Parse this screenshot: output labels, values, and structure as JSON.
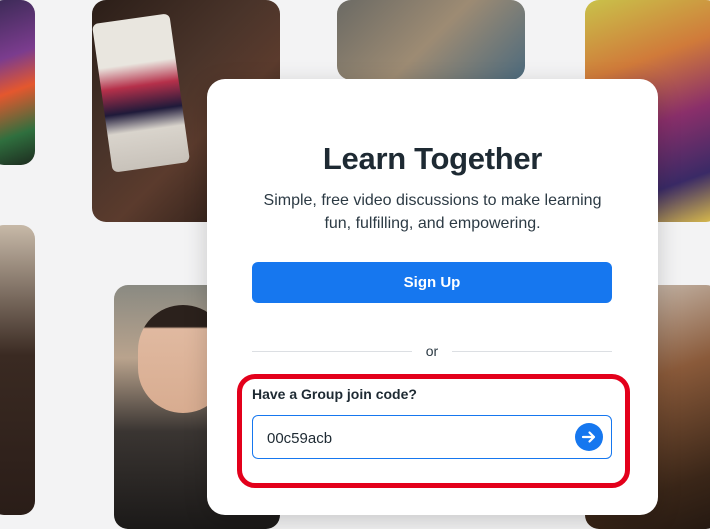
{
  "card": {
    "title": "Learn Together",
    "subtitle": "Simple, free video discussions to make learning fun, fulfilling, and empowering.",
    "signup_label": "Sign Up",
    "divider_text": "or",
    "join_label": "Have a Group join code?",
    "join_value": "00c59acb",
    "submit_icon": "arrow-right-icon"
  },
  "colors": {
    "accent": "#1677ef",
    "highlight": "#e3001b",
    "title": "#1e2a33"
  }
}
